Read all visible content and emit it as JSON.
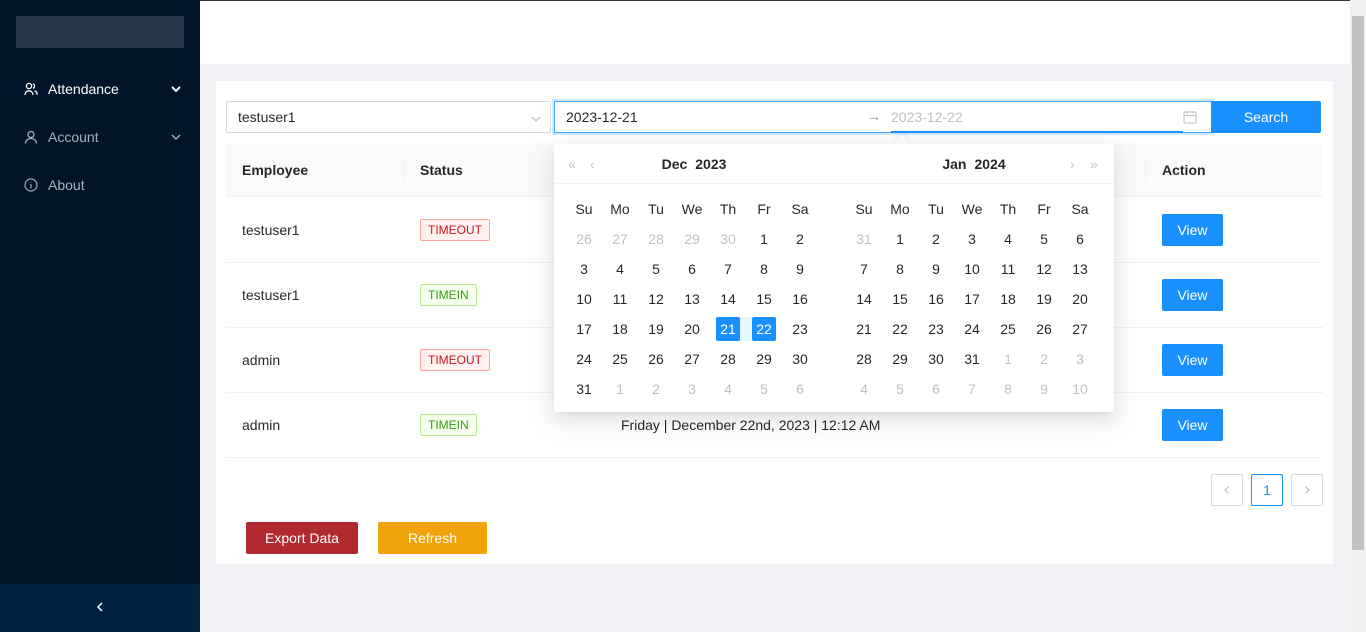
{
  "sidebar": {
    "items": [
      {
        "label": "Attendance",
        "icon": "team-icon",
        "active": true
      },
      {
        "label": "Account",
        "icon": "user-icon",
        "active": false
      },
      {
        "label": "About",
        "icon": "info-icon",
        "active": false
      }
    ],
    "collapse_icon": "chevron-left-icon"
  },
  "filters": {
    "user_select": "testuser1",
    "date_start": "2023-12-21",
    "date_end_placeholder": "2023-12-22",
    "separator": "→",
    "search_label": "Search"
  },
  "table": {
    "columns": [
      "Employee",
      "Status",
      "Action"
    ],
    "rows": [
      {
        "employee": "testuser1",
        "status": "TIMEOUT",
        "time": "",
        "action": "View"
      },
      {
        "employee": "testuser1",
        "status": "TIMEIN",
        "time": "",
        "action": "View"
      },
      {
        "employee": "admin",
        "status": "TIMEOUT",
        "time": "",
        "action": "View"
      },
      {
        "employee": "admin",
        "status": "TIMEIN",
        "time": "Friday | December 22nd, 2023 | 12:12 AM",
        "action": "View"
      }
    ]
  },
  "pagination": {
    "current": "1",
    "prev": "<",
    "next": ">"
  },
  "actions": {
    "export_label": "Export Data",
    "refresh_label": "Refresh"
  },
  "calendar": {
    "weekdays": [
      "Su",
      "Mo",
      "Tu",
      "We",
      "Th",
      "Fr",
      "Sa"
    ],
    "left": {
      "month": "Dec",
      "year": "2023",
      "weeks": [
        [
          "26",
          "27",
          "28",
          "29",
          "30",
          "1",
          "2"
        ],
        [
          "3",
          "4",
          "5",
          "6",
          "7",
          "8",
          "9"
        ],
        [
          "10",
          "11",
          "12",
          "13",
          "14",
          "15",
          "16"
        ],
        [
          "17",
          "18",
          "19",
          "20",
          "21",
          "22",
          "23"
        ],
        [
          "24",
          "25",
          "26",
          "27",
          "28",
          "29",
          "30"
        ],
        [
          "31",
          "1",
          "2",
          "3",
          "4",
          "5",
          "6"
        ]
      ]
    },
    "right": {
      "month": "Jan",
      "year": "2024",
      "weeks": [
        [
          "31",
          "1",
          "2",
          "3",
          "4",
          "5",
          "6"
        ],
        [
          "7",
          "8",
          "9",
          "10",
          "11",
          "12",
          "13"
        ],
        [
          "14",
          "15",
          "16",
          "17",
          "18",
          "19",
          "20"
        ],
        [
          "21",
          "22",
          "23",
          "24",
          "25",
          "26",
          "27"
        ],
        [
          "28",
          "29",
          "30",
          "31",
          "1",
          "2",
          "3"
        ],
        [
          "4",
          "5",
          "6",
          "7",
          "8",
          "9",
          "10"
        ]
      ]
    },
    "selected_start": "21",
    "selected_end": "22"
  },
  "colors": {
    "primary": "#1890ff",
    "sidebar": "#001529",
    "export": "#b02a30",
    "refresh": "#f0a30a",
    "timeout": "#cf1322",
    "timein": "#389e0d"
  }
}
